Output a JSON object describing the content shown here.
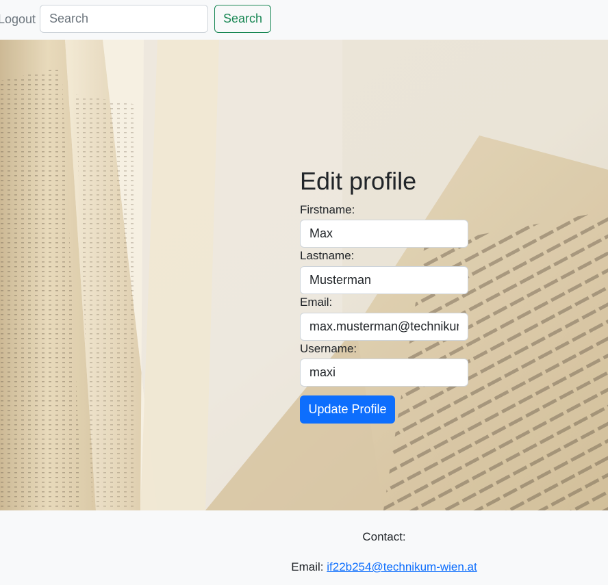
{
  "navbar": {
    "logout_label": "Logout",
    "search_placeholder": "Search",
    "search_button_label": "Search"
  },
  "form": {
    "title": "Edit profile",
    "firstname_label": "Firstname:",
    "firstname_value": "Max",
    "lastname_label": "Lastname:",
    "lastname_value": "Musterman",
    "email_label": "Email:",
    "email_value": "max.musterman@technikum-wien.at",
    "username_label": "Username:",
    "username_value": "maxi",
    "update_button_label": "Update Profile"
  },
  "footer": {
    "contact_heading": "Contact:",
    "email_prefix": "Email:",
    "email_link": "if22b254@technikum-wien.at"
  },
  "colors": {
    "primary": "#0d6efd",
    "success": "#198754",
    "muted": "#6c757d",
    "light_bg": "#f8f9fa"
  }
}
